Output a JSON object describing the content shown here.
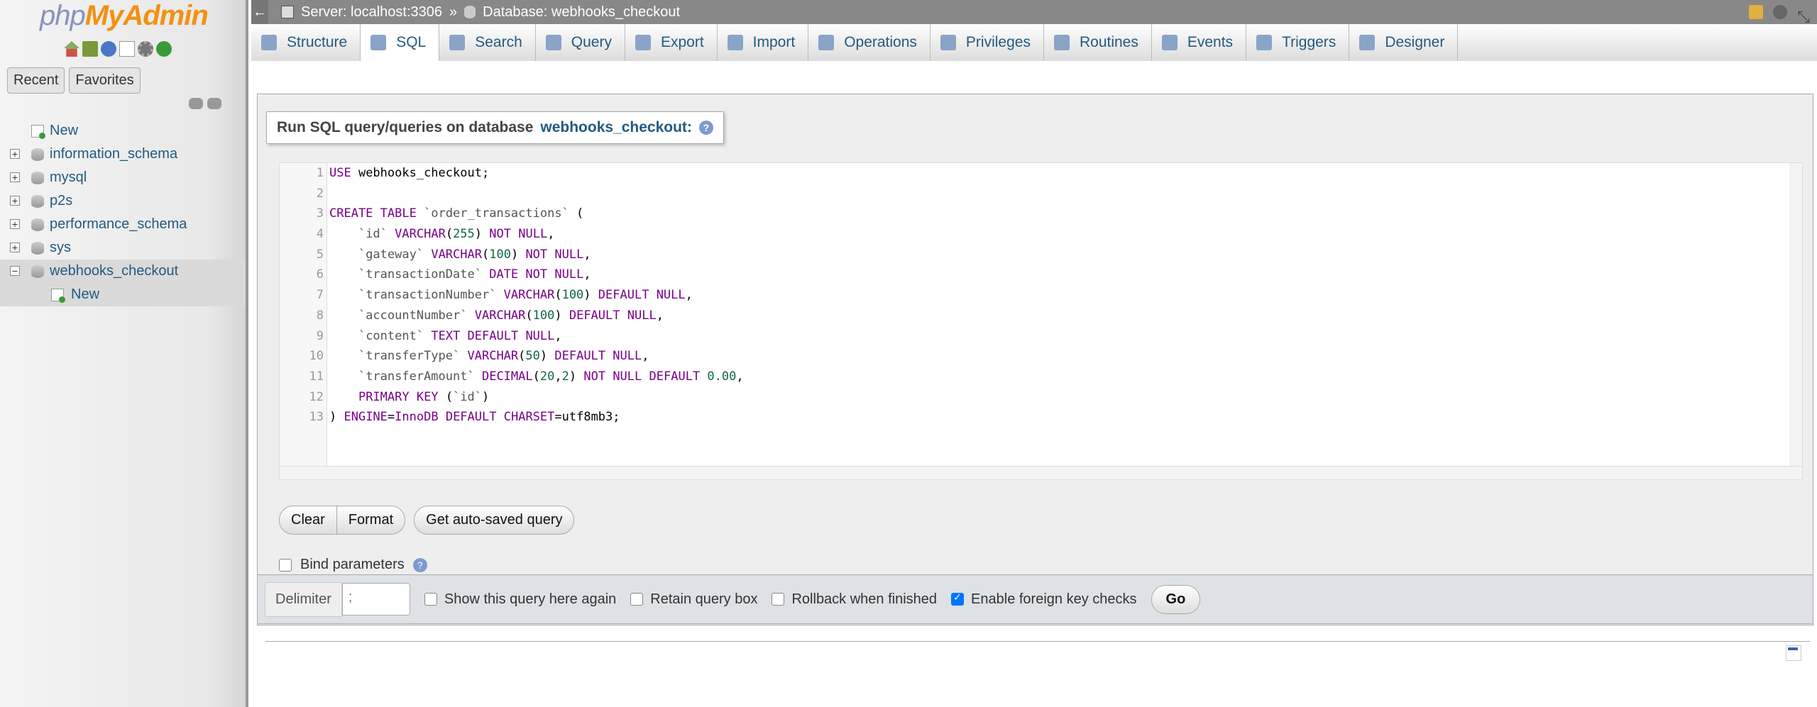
{
  "app": {
    "logo_php": "php",
    "logo_myadmin": "MyAdmin"
  },
  "nav": {
    "buttons": [
      "Recent",
      "Favorites"
    ],
    "tree": [
      {
        "label": "New",
        "type": "new"
      },
      {
        "label": "information_schema",
        "type": "db",
        "expanded": false
      },
      {
        "label": "mysql",
        "type": "db",
        "expanded": false
      },
      {
        "label": "p2s",
        "type": "db",
        "expanded": false
      },
      {
        "label": "performance_schema",
        "type": "db",
        "expanded": false
      },
      {
        "label": "sys",
        "type": "db",
        "expanded": false
      },
      {
        "label": "webhooks_checkout",
        "type": "db",
        "expanded": true
      },
      {
        "label": "New",
        "type": "new-child"
      }
    ]
  },
  "topbar": {
    "server": "Server: localhost:3306",
    "sep": "»",
    "database": "Database: webhooks_checkout"
  },
  "tabs": [
    "Structure",
    "SQL",
    "Search",
    "Query",
    "Export",
    "Import",
    "Operations",
    "Privileges",
    "Routines",
    "Events",
    "Triggers",
    "Designer"
  ],
  "active_tab": "SQL",
  "query": {
    "legend_prefix": "Run SQL query/queries on database",
    "legend_db": "webhooks_checkout:",
    "lines": [
      "USE webhooks_checkout;",
      "",
      "CREATE TABLE `order_transactions` (",
      "    `id` VARCHAR(255) NOT NULL,",
      "    `gateway` VARCHAR(100) NOT NULL,",
      "    `transactionDate` DATE NOT NULL,",
      "    `transactionNumber` VARCHAR(100) DEFAULT NULL,",
      "    `accountNumber` VARCHAR(100) DEFAULT NULL,",
      "    `content` TEXT DEFAULT NULL,",
      "    `transferType` VARCHAR(50) DEFAULT NULL,",
      "    `transferAmount` DECIMAL(20,2) NOT NULL DEFAULT 0.00,",
      "    PRIMARY KEY (`id`)",
      ") ENGINE=InnoDB DEFAULT CHARSET=utf8mb3;"
    ],
    "buttons": {
      "clear": "Clear",
      "format": "Format",
      "autosaved": "Get auto-saved query"
    },
    "bind_params": "Bind parameters"
  },
  "options": {
    "delimiter_label": "Delimiter",
    "delimiter_value": ";",
    "show_again": "Show this query here again",
    "retain": "Retain query box",
    "rollback": "Rollback when finished",
    "fk_checks": "Enable foreign key checks",
    "fk_checked": true,
    "go": "Go"
  }
}
